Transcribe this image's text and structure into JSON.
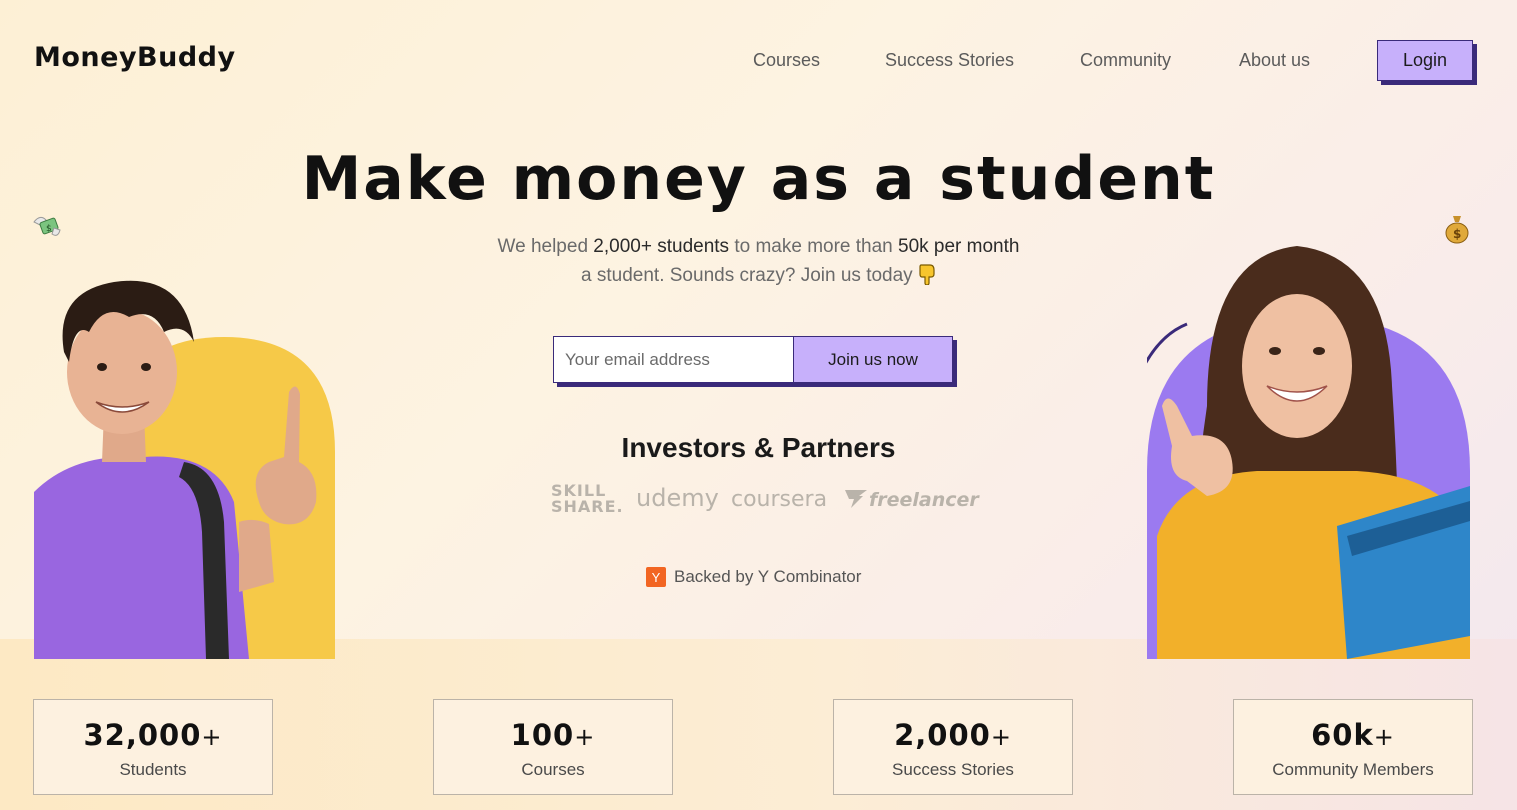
{
  "brand": {
    "name": "MoneyBuddy"
  },
  "nav": {
    "items": [
      "Courses",
      "Success Stories",
      "Community",
      "About us"
    ],
    "login_label": "Login"
  },
  "hero": {
    "headline": "Make money as a student",
    "sub_line1_pre": "We helped ",
    "sub_line1_strong1": "2,000+ students",
    "sub_line1_mid": " to make more than ",
    "sub_line1_strong2": "50k per month",
    "sub_line2": "a student. Sounds crazy? Join us today",
    "email_placeholder": "Your email address",
    "join_label": "Join us now"
  },
  "partners": {
    "title": "Investors & Partners",
    "logos": [
      "SKILL SHARE.",
      "udemy",
      "coursera",
      "freelancer"
    ]
  },
  "backed": {
    "badge": "Y",
    "text": "Backed by Y Combinator"
  },
  "stats": [
    {
      "value": "32,000",
      "suffix": "+",
      "label": "Students"
    },
    {
      "value": "100",
      "suffix": "+",
      "label": "Courses"
    },
    {
      "value": "2,000",
      "suffix": "+",
      "label": "Success Stories"
    },
    {
      "value": "60k",
      "suffix": "+",
      "label": "Community Members"
    }
  ],
  "colors": {
    "accent_purple": "#c7b0fb",
    "border_dark": "#3a2a7a",
    "yellow_arch": "#f6c948",
    "purple_arch": "#9b7af0",
    "yc_orange": "#f26522"
  },
  "icons": [
    "money-wings-icon",
    "money-bag-icon",
    "pointing-down-icon"
  ]
}
